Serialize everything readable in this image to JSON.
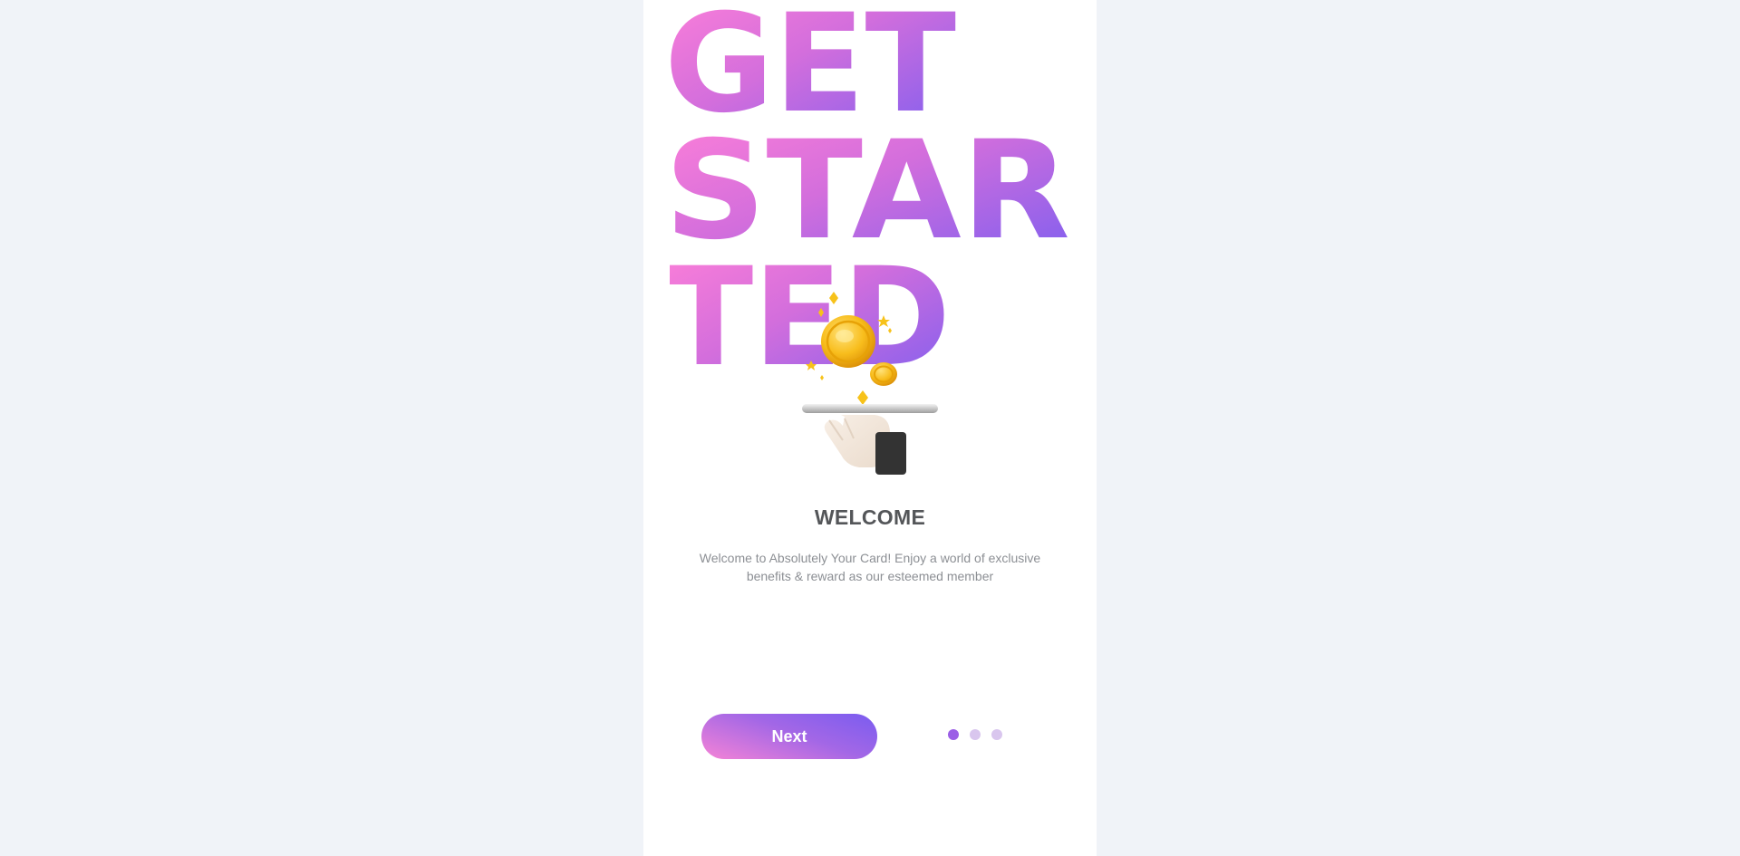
{
  "hero": {
    "line1": "GET",
    "line2": "STAR",
    "line3": "TED"
  },
  "illustration": {
    "icon": "coin-tray-hand-illustration"
  },
  "welcome": {
    "title": "WELCOME",
    "description": "Welcome to Absolutely Your Card! Enjoy a world of exclusive benefits & reward as our esteemed member"
  },
  "actions": {
    "next_label": "Next"
  },
  "pagination": {
    "total": 3,
    "active_index": 0
  },
  "colors": {
    "page_background": "#f0f3f8",
    "card_background": "#ffffff",
    "gradient_pink": "#ff80d8",
    "gradient_purple": "#7b5ef0",
    "title_text": "#545659",
    "body_text": "#8c8f94",
    "dot_active": "#9b5ee6",
    "dot_inactive": "#d9c6ee",
    "coin_gold": "#f5b40f"
  }
}
